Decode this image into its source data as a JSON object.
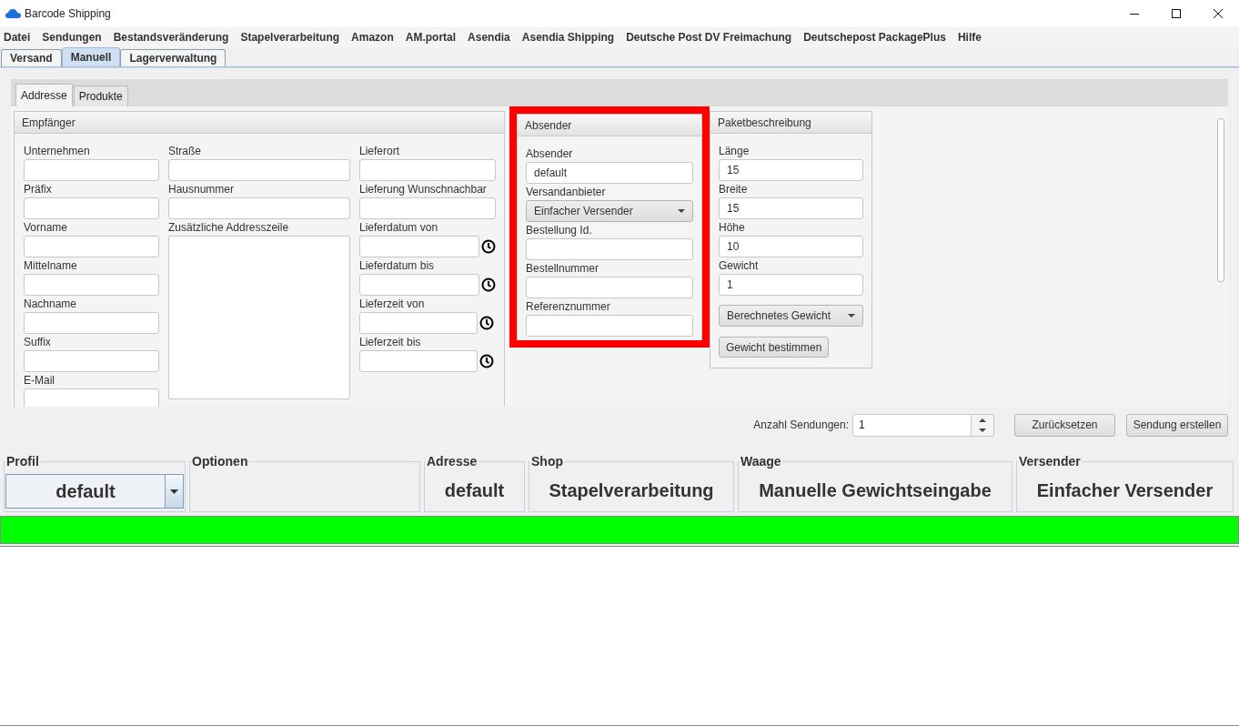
{
  "window": {
    "title": "Barcode Shipping"
  },
  "menu": [
    "Datei",
    "Sendungen",
    "Bestandsveränderung",
    "Stapelverarbeitung",
    "Amazon",
    "AM.portal",
    "Asendia",
    "Asendia Shipping",
    "Deutsche Post DV Freimachung",
    "Deutschepost PackagePlus",
    "Hilfe"
  ],
  "main_tabs": [
    {
      "label": "Versand",
      "selected": false
    },
    {
      "label": "Manuell",
      "selected": true
    },
    {
      "label": "Lagerverwaltung",
      "selected": false
    }
  ],
  "sub_tabs": [
    {
      "label": "Addresse",
      "selected": true
    },
    {
      "label": "Produkte",
      "selected": false
    }
  ],
  "recipient": {
    "title": "Empfänger",
    "columns": [
      [
        {
          "label": "Unternehmen",
          "kind": "text"
        },
        {
          "label": "Präfix",
          "kind": "text"
        },
        {
          "label": "Vorname",
          "kind": "text"
        },
        {
          "label": "Mittelname",
          "kind": "text"
        },
        {
          "label": "Nachname",
          "kind": "text"
        },
        {
          "label": "Suffix",
          "kind": "text"
        },
        {
          "label": "E-Mail",
          "kind": "text"
        }
      ],
      [
        {
          "label": "Straße",
          "kind": "text"
        },
        {
          "label": "Hausnummer",
          "kind": "text"
        },
        {
          "label": "Zusätzliche Addresszeile",
          "kind": "textarea"
        }
      ],
      [
        {
          "label": "Lieferort",
          "kind": "text"
        },
        {
          "label": "Lieferung Wunschnachbar",
          "kind": "text"
        },
        {
          "label": "Lieferdatum von",
          "kind": "date"
        },
        {
          "label": "Lieferdatum bis",
          "kind": "date"
        },
        {
          "label": "Lieferzeit von",
          "kind": "time"
        },
        {
          "label": "Lieferzeit bis",
          "kind": "time"
        }
      ]
    ]
  },
  "sender": {
    "title": "Absender",
    "highlighted": true,
    "fields": [
      {
        "label": "Absender",
        "kind": "text",
        "value": "default"
      },
      {
        "label": "Versandanbieter",
        "kind": "select",
        "value": "Einfacher Versender"
      },
      {
        "label": "Bestellung Id.",
        "kind": "text"
      },
      {
        "label": "Bestellnummer",
        "kind": "text"
      },
      {
        "label": "Referenznummer",
        "kind": "text"
      }
    ]
  },
  "package": {
    "title": "Paketbeschreibung",
    "highlighted": false,
    "fields": [
      {
        "label": "Länge",
        "kind": "text",
        "value": "15"
      },
      {
        "label": "Breite",
        "kind": "text",
        "value": "15"
      },
      {
        "label": "Höhe",
        "kind": "text",
        "value": "10"
      },
      {
        "label": "Gewicht",
        "kind": "text",
        "value": "1"
      },
      {
        "kind": "select",
        "value": "Berechnetes Gewicht"
      },
      {
        "kind": "button",
        "value": "Gewicht bestimmen"
      }
    ]
  },
  "actions": {
    "count_label": "Anzahl Sendungen:",
    "count_value": "1",
    "buttons": [
      "Zurücksetzen",
      "Sendung erstellen"
    ]
  },
  "status_groups": [
    {
      "title": "Profil",
      "kind": "select",
      "value": "default"
    },
    {
      "title": "Optionen",
      "kind": "empty"
    },
    {
      "title": "Adresse",
      "kind": "text",
      "value": "default"
    },
    {
      "title": "Shop",
      "kind": "text",
      "value": "Stapelverarbeitung"
    },
    {
      "title": "Waage",
      "kind": "text",
      "value": "Manuelle Gewichtseingabe"
    },
    {
      "title": "Versender",
      "kind": "text",
      "value": "Einfacher Versender"
    }
  ],
  "progress": {
    "level": 1
  }
}
